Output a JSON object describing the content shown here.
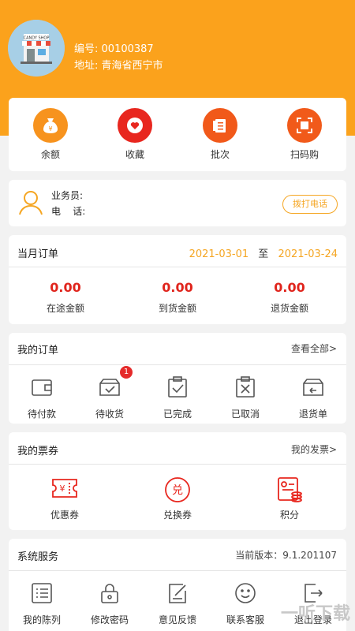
{
  "profile": {
    "shop_sign": "CANDY SHOP",
    "code_label": "编号:",
    "code_value": "00100387",
    "address_label": "地址:",
    "address_value": "青海省西宁市"
  },
  "quick_actions": [
    {
      "label": "余额",
      "icon": "money-bag-icon",
      "glyph": "¥"
    },
    {
      "label": "收藏",
      "icon": "heart-icon"
    },
    {
      "label": "批次",
      "icon": "list-icon"
    },
    {
      "label": "扫码购",
      "icon": "scan-icon"
    }
  ],
  "salesman": {
    "name_label": "业务员:",
    "phone_label": "电    话:",
    "call_button": "拨打电话"
  },
  "monthly_orders": {
    "title": "当月订单",
    "date_from": "2021-03-01",
    "to_label": "至",
    "date_to": "2021-03-24",
    "stats": [
      {
        "value": "0.00",
        "label": "在途金额"
      },
      {
        "value": "0.00",
        "label": "到货金额"
      },
      {
        "value": "0.00",
        "label": "退货金额"
      }
    ]
  },
  "my_orders": {
    "title": "我的订单",
    "view_all": "查看全部>",
    "items": [
      {
        "label": "待付款",
        "icon": "wallet-icon"
      },
      {
        "label": "待收货",
        "icon": "box-icon",
        "badge": "1"
      },
      {
        "label": "已完成",
        "icon": "clipboard-check-icon"
      },
      {
        "label": "已取消",
        "icon": "clipboard-x-icon"
      },
      {
        "label": "退货单",
        "icon": "return-box-icon"
      }
    ]
  },
  "coupons": {
    "title": "我的票券",
    "invoice_link": "我的发票>",
    "items": [
      {
        "label": "优惠券",
        "icon": "coupon-icon",
        "glyph": "¥"
      },
      {
        "label": "兑换券",
        "icon": "exchange-icon",
        "glyph": "兑"
      },
      {
        "label": "积分",
        "icon": "points-icon"
      }
    ]
  },
  "services": {
    "title": "系统服务",
    "version": "当前版本：9.1.201107",
    "items": [
      {
        "label": "我的陈列",
        "icon": "display-list-icon"
      },
      {
        "label": "修改密码",
        "icon": "lock-icon"
      },
      {
        "label": "意见反馈",
        "icon": "feedback-icon"
      },
      {
        "label": "联系客服",
        "icon": "smile-icon"
      },
      {
        "label": "退出登录",
        "icon": "logout-icon"
      }
    ]
  },
  "watermark": "一听下载",
  "colors": {
    "primary": "#fba21c",
    "accent_red": "#e0251d",
    "date_orange": "#f5a623",
    "icon_orange": "#f7841c"
  }
}
